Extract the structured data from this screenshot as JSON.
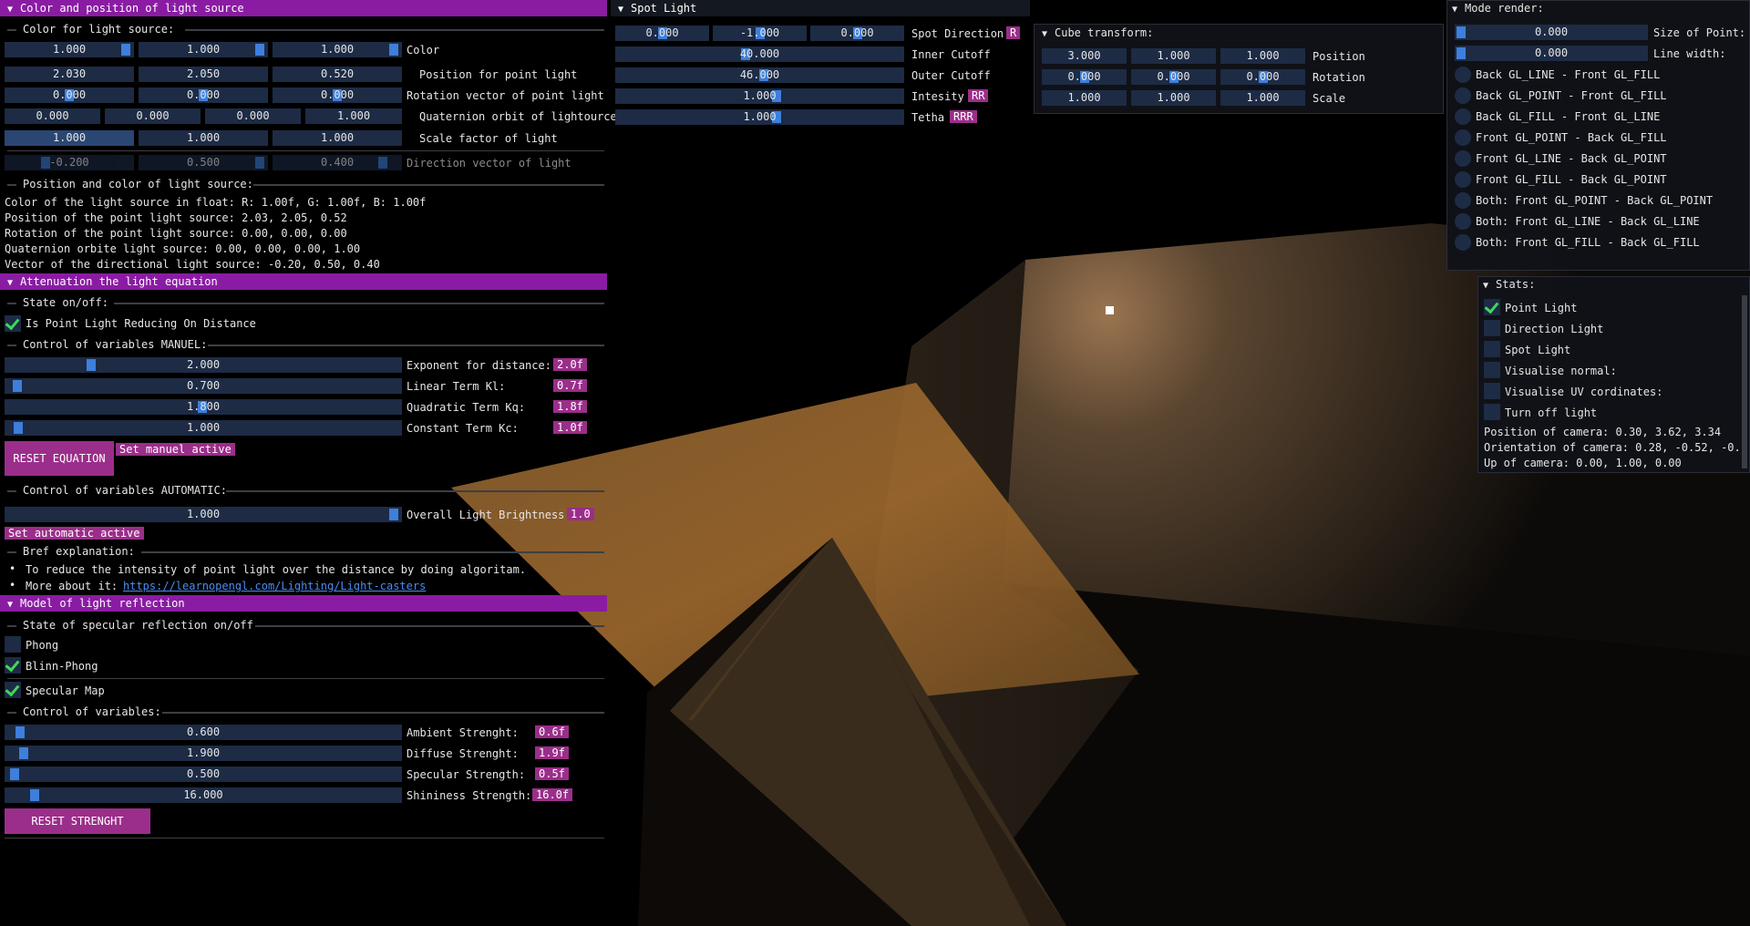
{
  "colors": {
    "accent": "#8a1ca3",
    "field": "#1d2b45",
    "grab": "#3d7fdb",
    "badge": "#9b2e8a",
    "check": "#3fd85a"
  },
  "light_panel": {
    "title": "Color and position of light source",
    "sec_color": "Color for light source:",
    "color": {
      "values": [
        "1.000",
        "1.000",
        "1.000"
      ],
      "label": "Color"
    },
    "position": {
      "values": [
        "2.030",
        "2.050",
        "0.520"
      ],
      "label": "Position for point light"
    },
    "rotation": {
      "values": [
        "0.000",
        "0.000",
        "0.000"
      ],
      "label": "Rotation vector of point light"
    },
    "quaternion": {
      "values": [
        "0.000",
        "0.000",
        "0.000",
        "1.000"
      ],
      "label": "Quaternion orbit of lightource"
    },
    "scale": {
      "values": [
        "1.000",
        "1.000",
        "1.000"
      ],
      "label": "Scale factor of light"
    },
    "direction": {
      "values": [
        "-0.200",
        "0.500",
        "0.400"
      ],
      "label": "Direction vector of light"
    },
    "sec_info": "Position and color of light source:",
    "info": [
      "Color of the light source in float: R: 1.00f, G: 1.00f, B: 1.00f",
      "Position of the point light source: 2.03, 2.05, 0.52",
      "Rotation of the point light source: 0.00, 0.00, 0.00",
      "Quaternion orbite light source: 0.00, 0.00, 0.00, 1.00",
      "Vector of the directional light source: -0.20, 0.50, 0.40"
    ]
  },
  "atten": {
    "title": "Attenuation the light equation",
    "sec_state": "State on/off:",
    "chk_label": "Is Point Light Reducing On Distance",
    "sec_manual": "Control of variables MANUEL:",
    "rows": [
      {
        "value": "2.000",
        "label": "Exponent for distance:",
        "badge": "2.0f"
      },
      {
        "value": "0.700",
        "label": "Linear Term Kl:",
        "badge": "0.7f"
      },
      {
        "value": "1.800",
        "label": "Quadratic Term Kq:",
        "badge": "1.8f"
      },
      {
        "value": "1.000",
        "label": "Constant Term Kc:",
        "badge": "1.0f"
      }
    ],
    "reset_label": "RESET EQUATION",
    "set_manual": "Set manuel active",
    "sec_auto": "Control of variables AUTOMATIC:",
    "brightness": {
      "value": "1.000",
      "label": "Overall Light Brightness:",
      "badge": "1.0"
    },
    "set_auto": "Set automatic active",
    "sec_expl": "Bref explanation:",
    "bullet1": "To reduce the intensity of point light over the distance by doing algoritam.",
    "bullet2": "More about it:",
    "link": "https://learnopengl.com/Lighting/Light-casters"
  },
  "reflection": {
    "title": "Model of light reflection",
    "sec_state": "State of specular reflection on/off",
    "phong": "Phong",
    "blinn": "Blinn-Phong",
    "specmap": "Specular Map",
    "sec_vars": "Control of variables:",
    "rows": [
      {
        "value": "0.600",
        "label": "Ambient Strenght:",
        "badge": "0.6f"
      },
      {
        "value": "1.900",
        "label": "Diffuse Strenght:",
        "badge": "1.9f"
      },
      {
        "value": "0.500",
        "label": "Specular Strength:",
        "badge": "0.5f"
      },
      {
        "value": "16.000",
        "label": "Shininess Strength:",
        "badge": "16.0f"
      }
    ],
    "reset_label": "RESET STRENGHT"
  },
  "spot": {
    "title": "Spot Light",
    "direction": {
      "values": [
        "0.000",
        "-1.000",
        "0.000"
      ],
      "label": "Spot Direction",
      "badge": "R"
    },
    "inner": {
      "value": "40.000",
      "label": "Inner Cutoff"
    },
    "outer": {
      "value": "46.000",
      "label": "Outer Cutoff"
    },
    "intensity": {
      "value": "1.000",
      "label": "Intesity",
      "badge": "RR"
    },
    "tetha": {
      "value": "1.000",
      "label": "Tetha",
      "badge": "RRR"
    }
  },
  "cube": {
    "title": "Cube transform:",
    "position": {
      "values": [
        "3.000",
        "1.000",
        "1.000"
      ],
      "label": "Position"
    },
    "rotation": {
      "values": [
        "0.000",
        "0.000",
        "0.000"
      ],
      "label": "Rotation"
    },
    "scale": {
      "values": [
        "1.000",
        "1.000",
        "1.000"
      ],
      "label": "Scale"
    }
  },
  "mode": {
    "title": "Mode render:",
    "point_size": {
      "value": "0.000",
      "label": "Size of Point:"
    },
    "line_width": {
      "value": "0.000",
      "label": "Line width:"
    },
    "options": [
      "Back GL_LINE - Front GL_FILL",
      "Back GL_POINT - Front GL_FILL",
      "Back GL_FILL - Front GL_LINE",
      "Front GL_POINT - Back GL_FILL",
      "Front GL_LINE - Back GL_POINT",
      "Front GL_FILL - Back GL_POINT",
      "Both: Front GL_POINT - Back GL_POINT",
      "Both: Front GL_LINE - Back GL_LINE",
      "Both: Front GL_FILL - Back GL_FILL"
    ]
  },
  "stats": {
    "title": "Stats:",
    "checks": [
      {
        "label": "Point Light",
        "checked": true
      },
      {
        "label": "Direction Light",
        "checked": false
      },
      {
        "label": "Spot Light",
        "checked": false
      },
      {
        "label": "Visualise normal:",
        "checked": false
      },
      {
        "label": "Visualise UV cordinates:",
        "checked": false
      },
      {
        "label": "Turn off light",
        "checked": false
      }
    ],
    "cam_pos": "Position of camera: 0.30, 3.62, 3.34",
    "cam_orient": "Orientation of camera: 0.28, -0.52, -0.",
    "cam_up": "Up of camera: 0.00, 1.00, 0.00"
  }
}
